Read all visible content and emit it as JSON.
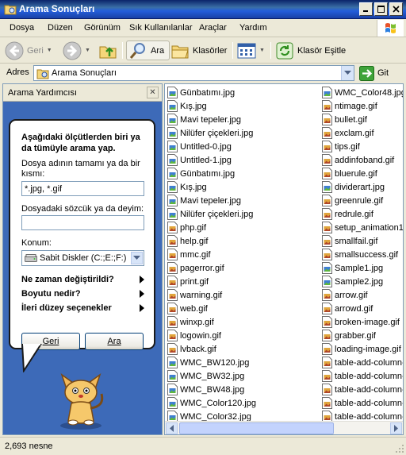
{
  "window": {
    "title": "Arama Sonuçları"
  },
  "menu": {
    "items": [
      {
        "label": "Dosya"
      },
      {
        "label": "Düzen"
      },
      {
        "label": "Görünüm"
      },
      {
        "label": "Sık Kullanılanlar"
      },
      {
        "label": "Araçlar"
      },
      {
        "label": "Yardım"
      }
    ]
  },
  "toolbar": {
    "back_label": "Geri",
    "search_label": "Ara",
    "folders_label": "Klasörler",
    "sync_label": "Klasör Eşitle"
  },
  "address": {
    "label": "Adres",
    "value": "Arama Sonuçları",
    "go_label": "Git"
  },
  "search_pane": {
    "title": "Arama Yardımcısı",
    "prompt": "Aşağıdaki ölçütlerden biri ya da tümüyle arama yap.",
    "filename_label": "Dosya adının tamamı ya da bir kısmı:",
    "filename_value": "*.jpg, *.gif",
    "word_label": "Dosyadaki sözcük ya da deyim:",
    "word_value": "",
    "location_label": "Konum:",
    "location_value": "Sabit Diskler (C:;E:;F:)",
    "options": [
      {
        "label": "Ne zaman değiştirildi?"
      },
      {
        "label": "Boyutu nedir?"
      },
      {
        "label": "İleri düzey seçenekler"
      }
    ],
    "back_button": "Geri",
    "search_button": "Ara"
  },
  "files": {
    "column1": [
      {
        "name": "Günbatımı.jpg",
        "type": "jpg"
      },
      {
        "name": "Kış.jpg",
        "type": "jpg"
      },
      {
        "name": "Mavi tepeler.jpg",
        "type": "jpg"
      },
      {
        "name": "Nilüfer çiçekleri.jpg",
        "type": "jpg"
      },
      {
        "name": "Untitled-0.jpg",
        "type": "jpg"
      },
      {
        "name": "Untitled-1.jpg",
        "type": "jpg"
      },
      {
        "name": "Günbatımı.jpg",
        "type": "jpg"
      },
      {
        "name": "Kış.jpg",
        "type": "jpg"
      },
      {
        "name": "Mavi tepeler.jpg",
        "type": "jpg"
      },
      {
        "name": "Nilüfer çiçekleri.jpg",
        "type": "jpg"
      },
      {
        "name": "php.gif",
        "type": "gif"
      },
      {
        "name": "help.gif",
        "type": "gif"
      },
      {
        "name": "mmc.gif",
        "type": "gif"
      },
      {
        "name": "pagerror.gif",
        "type": "gif"
      },
      {
        "name": "print.gif",
        "type": "gif"
      },
      {
        "name": "warning.gif",
        "type": "gif"
      },
      {
        "name": "web.gif",
        "type": "gif"
      },
      {
        "name": "winxp.gif",
        "type": "gif"
      },
      {
        "name": "logowin.gif",
        "type": "gif"
      },
      {
        "name": "lvback.gif",
        "type": "gif"
      },
      {
        "name": "WMC_BW120.jpg",
        "type": "jpg"
      },
      {
        "name": "WMC_BW32.jpg",
        "type": "jpg"
      },
      {
        "name": "WMC_BW48.jpg",
        "type": "jpg"
      },
      {
        "name": "WMC_Color120.jpg",
        "type": "jpg"
      },
      {
        "name": "WMC_Color32.jpg",
        "type": "jpg"
      }
    ],
    "column2": [
      {
        "name": "WMC_Color48.jpg",
        "type": "jpg"
      },
      {
        "name": "ntimage.gif",
        "type": "gif"
      },
      {
        "name": "bullet.gif",
        "type": "gif"
      },
      {
        "name": "exclam.gif",
        "type": "gif"
      },
      {
        "name": "tips.gif",
        "type": "gif"
      },
      {
        "name": "addinfoband.gif",
        "type": "gif"
      },
      {
        "name": "bluerule.gif",
        "type": "gif"
      },
      {
        "name": "dividerart.jpg",
        "type": "jpg"
      },
      {
        "name": "greenrule.gif",
        "type": "gif"
      },
      {
        "name": "redrule.gif",
        "type": "gif"
      },
      {
        "name": "setup_animation1",
        "type": "gif"
      },
      {
        "name": "smallfail.gif",
        "type": "gif"
      },
      {
        "name": "smallsuccess.gif",
        "type": "gif"
      },
      {
        "name": "Sample1.jpg",
        "type": "jpg"
      },
      {
        "name": "Sample2.jpg",
        "type": "jpg"
      },
      {
        "name": "arrow.gif",
        "type": "gif"
      },
      {
        "name": "arrowd.gif",
        "type": "gif"
      },
      {
        "name": "broken-image.gif",
        "type": "gif"
      },
      {
        "name": "grabber.gif",
        "type": "gif"
      },
      {
        "name": "loading-image.gif",
        "type": "gif"
      },
      {
        "name": "table-add-column-",
        "type": "gif"
      },
      {
        "name": "table-add-column-",
        "type": "gif"
      },
      {
        "name": "table-add-column-",
        "type": "gif"
      },
      {
        "name": "table-add-column-",
        "type": "gif"
      },
      {
        "name": "table-add-column-",
        "type": "gif"
      }
    ]
  },
  "status": {
    "text": "2,693 nesne"
  },
  "colors": {
    "titlebar": "#245edb",
    "search_pane_bg": "#3d6ab8",
    "window_bg": "#ece9d8"
  }
}
